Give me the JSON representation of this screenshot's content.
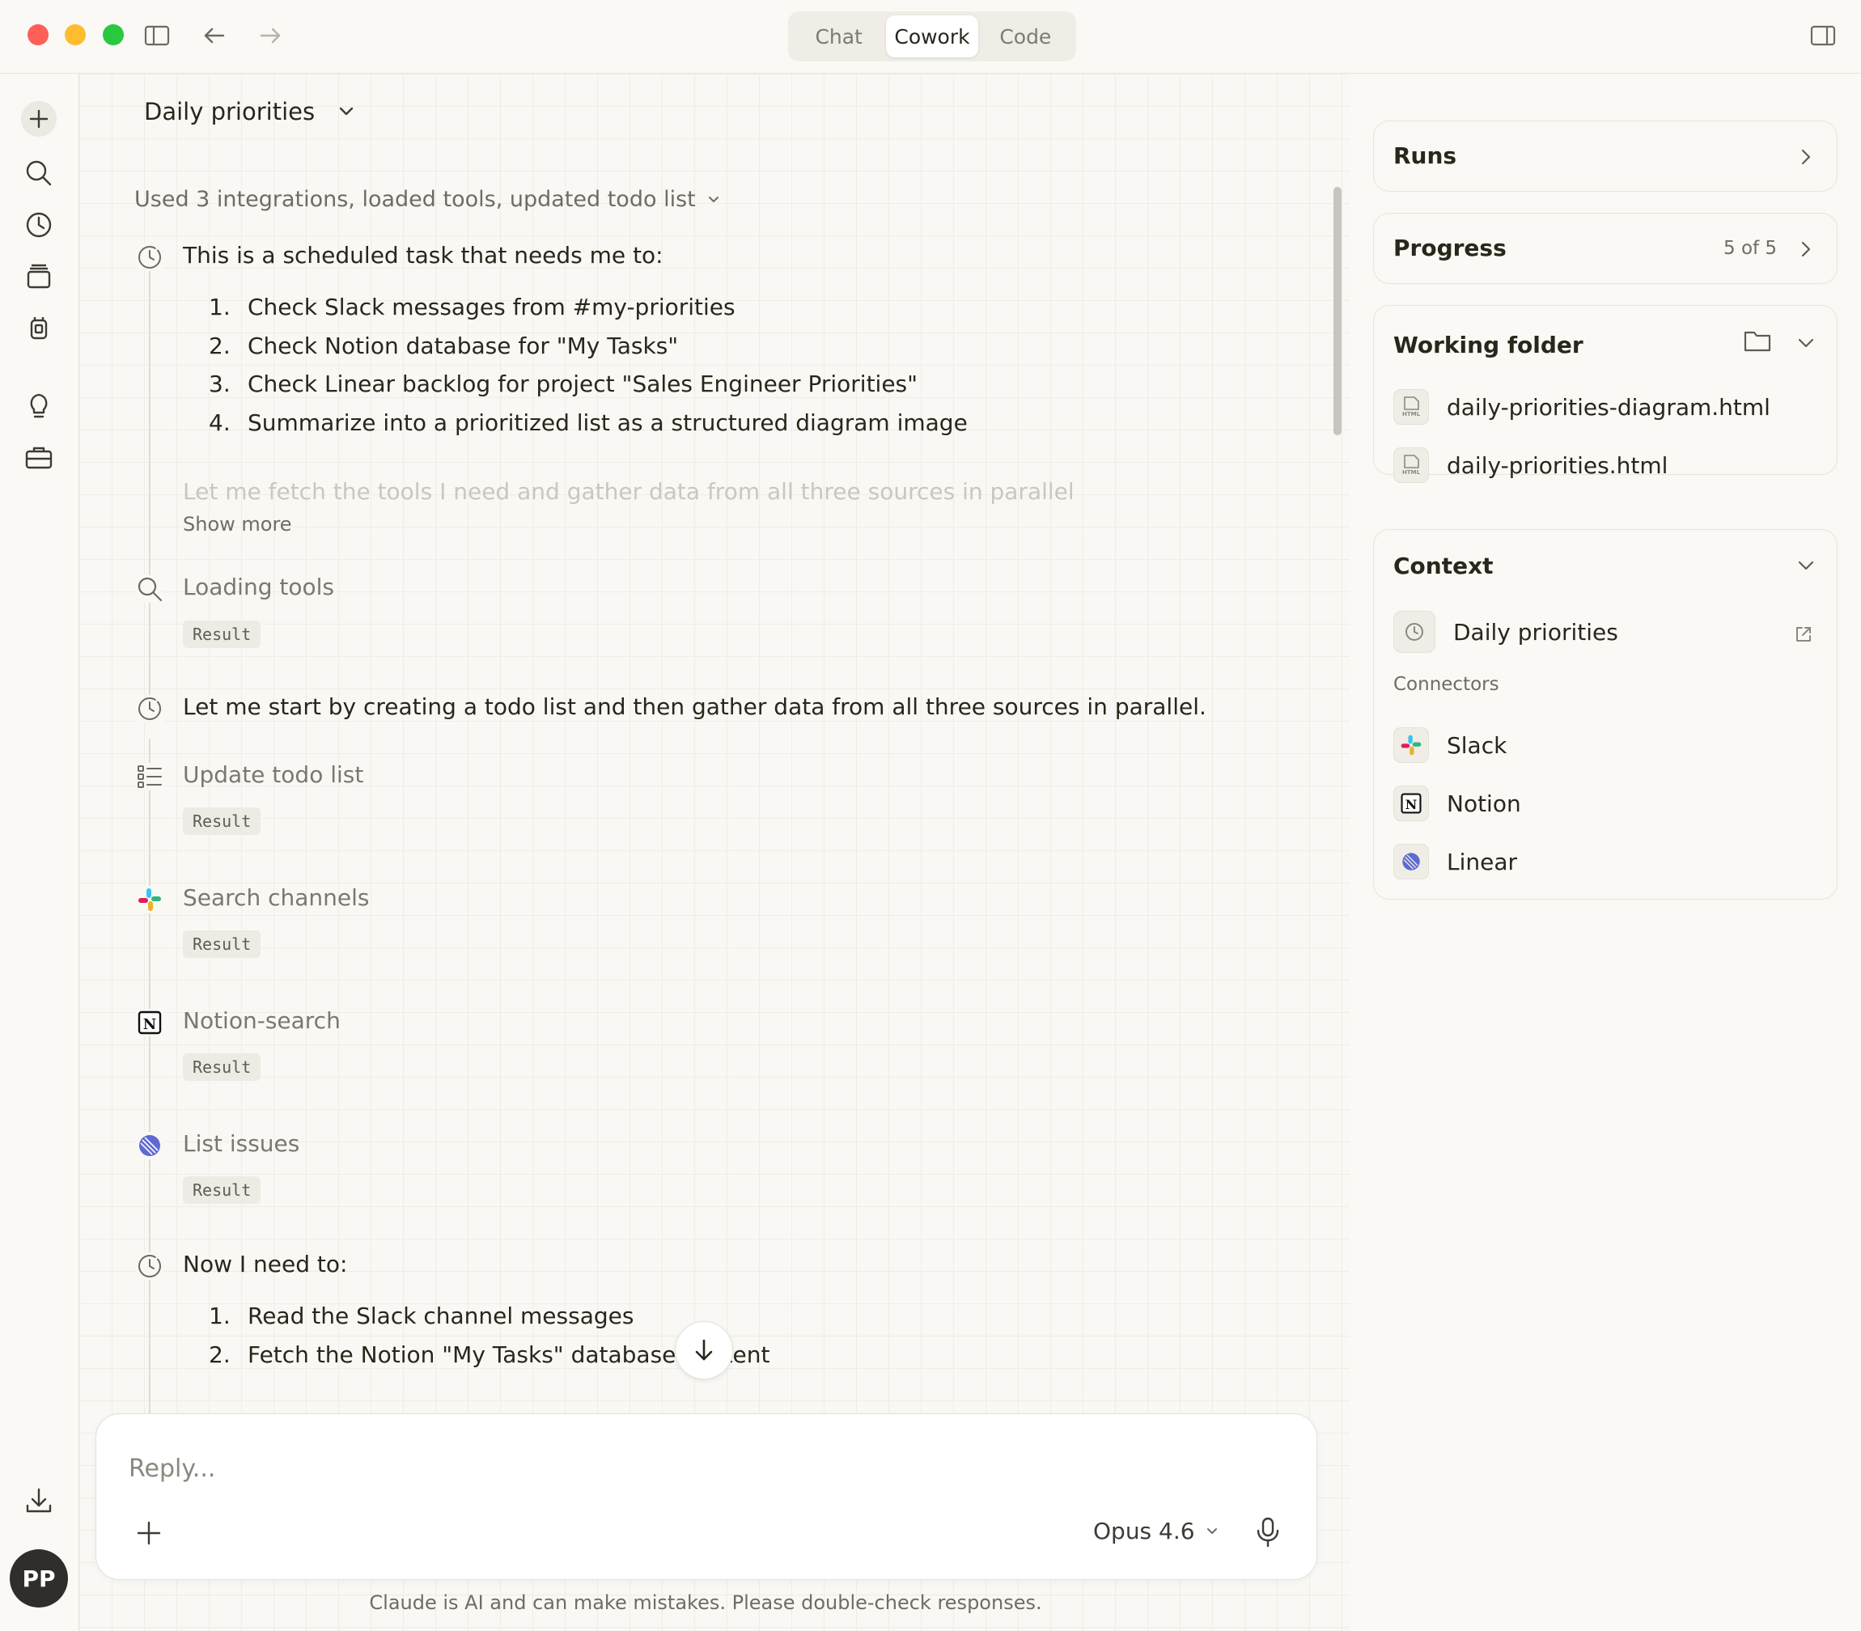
{
  "window": {
    "mode_tabs": [
      {
        "label": "Chat",
        "active": false
      },
      {
        "label": "Cowork",
        "active": true
      },
      {
        "label": "Code",
        "active": false
      }
    ]
  },
  "sidebar": {
    "icons": [
      "new-chat-icon",
      "search-icon",
      "history-icon",
      "projects-icon",
      "artifacts-icon",
      "lightbulb-icon",
      "toolbox-icon",
      "download-icon"
    ],
    "avatar_initials": "PP"
  },
  "task": {
    "title": "Daily priorities",
    "summary": "Used 3 integrations, loaded tools, updated todo list",
    "intro": "This is a scheduled task that needs me to:",
    "intro_list": [
      {
        "num": "1.",
        "text": "Check Slack messages from #my-priorities"
      },
      {
        "num": "2.",
        "text": "Check Notion database for \"My Tasks\""
      },
      {
        "num": "3.",
        "text": "Check Linear backlog for project \"Sales Engineer Priorities\""
      },
      {
        "num": "4.",
        "text": "Summarize into a prioritized list as a structured diagram image"
      }
    ],
    "faded_text": "Let me fetch the tools I need and gather data from all three sources in parallel.",
    "show_more": "Show more",
    "steps": {
      "loading_tools": {
        "label": "Loading tools",
        "result": "Result"
      },
      "start_message": "Let me start by creating a todo list and then gather data from all three sources in parallel.",
      "update_todo": {
        "label": "Update todo list",
        "result": "Result"
      },
      "search_channels": {
        "label": "Search channels",
        "result": "Result"
      },
      "notion_search": {
        "label": "Notion-search",
        "result": "Result"
      },
      "list_issues": {
        "label": "List issues",
        "result": "Result"
      }
    },
    "next_intro": "Now I need to:",
    "next_list": [
      {
        "num": "1.",
        "text": "Read the Slack channel messages"
      },
      {
        "num": "2.",
        "text": "Fetch the Notion \"My Tasks\" database content"
      }
    ]
  },
  "composer": {
    "placeholder": "Reply...",
    "model": "Opus 4.6",
    "disclaimer": "Claude is AI and can make mistakes. Please double-check responses."
  },
  "right_panel": {
    "runs": {
      "title": "Runs"
    },
    "progress": {
      "title": "Progress",
      "count": "5 of 5"
    },
    "working_folder": {
      "title": "Working folder",
      "files": [
        {
          "name": "daily-priorities-diagram.html",
          "icon_label": "HTML"
        },
        {
          "name": "daily-priorities.html",
          "icon_label": "HTML"
        }
      ]
    },
    "context": {
      "title": "Context",
      "task_name": "Daily priorities",
      "connectors_label": "Connectors",
      "connectors": [
        "Slack",
        "Notion",
        "Linear"
      ]
    }
  },
  "colors": {
    "background": "#faf9f5",
    "text": "#29261b",
    "muted": "#6e6c64",
    "linear_accent": "#5e6ad2"
  }
}
